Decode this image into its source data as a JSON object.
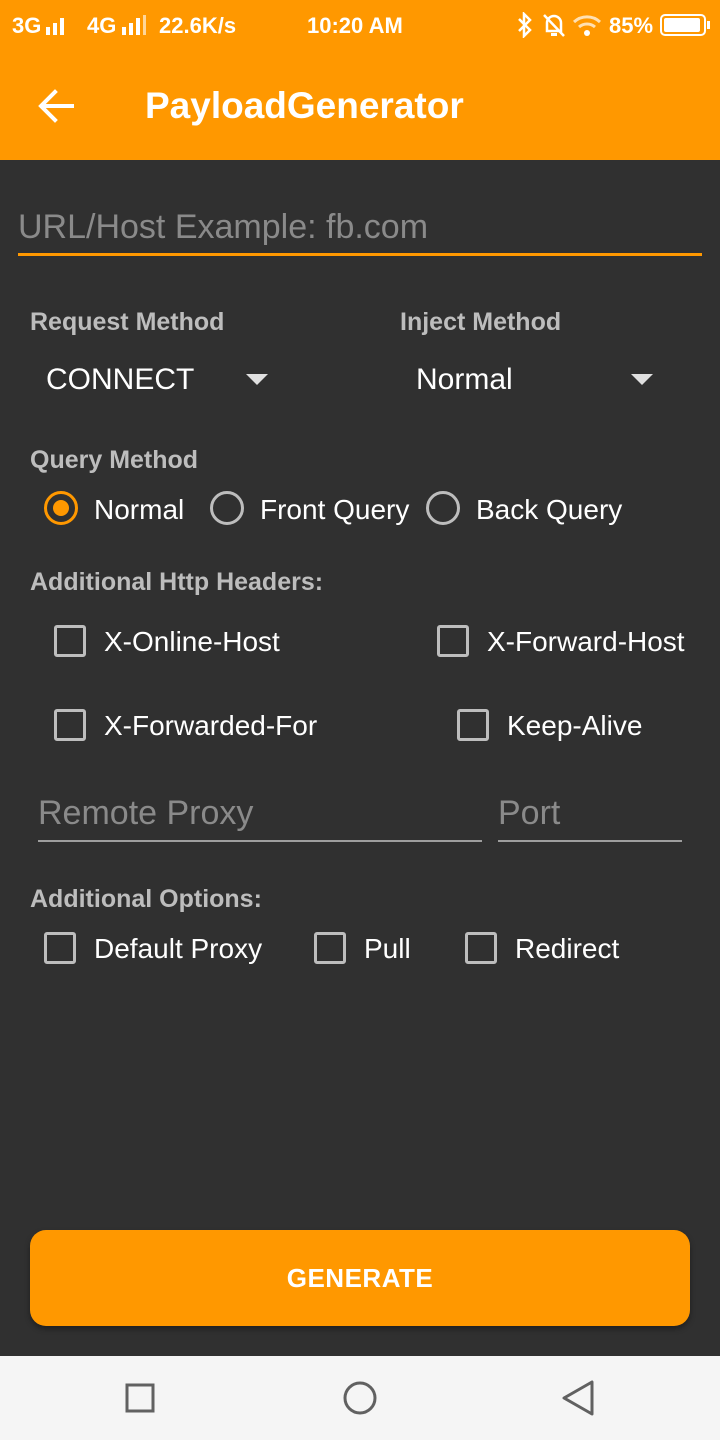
{
  "status_bar": {
    "net1": "3G",
    "net2": "4G",
    "speed": "22.6K/s",
    "time": "10:20 AM",
    "battery": "85%"
  },
  "app_bar": {
    "title": "PayloadGenerator",
    "back_icon": "arrow-left-icon"
  },
  "url_field": {
    "value": "",
    "placeholder": "URL/Host Example: fb.com"
  },
  "request_method": {
    "label": "Request Method",
    "selected": "CONNECT"
  },
  "inject_method": {
    "label": "Inject Method",
    "selected": "Normal"
  },
  "query_method": {
    "label": "Query Method",
    "options": [
      {
        "label": "Normal",
        "checked": true
      },
      {
        "label": "Front Query",
        "checked": false
      },
      {
        "label": "Back Query",
        "checked": false
      }
    ]
  },
  "headers": {
    "label": "Additional Http Headers:",
    "items": [
      {
        "label": "X-Online-Host",
        "checked": false
      },
      {
        "label": "X-Forward-Host",
        "checked": false
      },
      {
        "label": "X-Forwarded-For",
        "checked": false
      },
      {
        "label": "Keep-Alive",
        "checked": false
      }
    ]
  },
  "proxy": {
    "remote_placeholder": "Remote Proxy",
    "port_placeholder": "Port"
  },
  "options": {
    "label": "Additional Options:",
    "items": [
      {
        "label": "Default Proxy",
        "checked": false
      },
      {
        "label": "Pull",
        "checked": false
      },
      {
        "label": "Redirect",
        "checked": false
      }
    ]
  },
  "generate_label": "GENERATE",
  "colors": {
    "accent": "#FF9800",
    "background": "#303030"
  }
}
